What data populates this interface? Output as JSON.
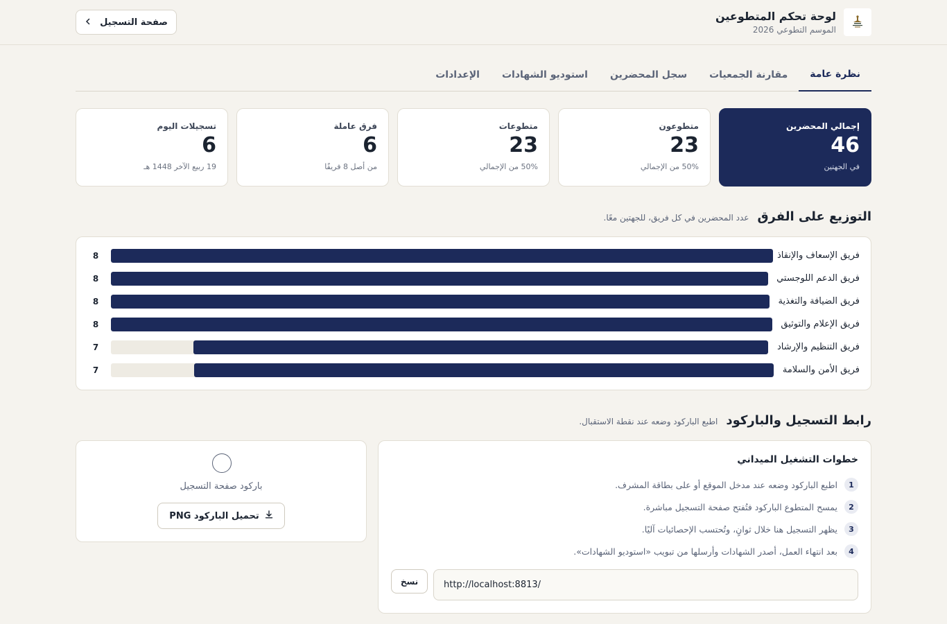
{
  "header": {
    "title": "لوحة تحكم المتطوعين",
    "subtitle": "الموسم التطوعي 2026",
    "registration_button": "صفحة التسجيل"
  },
  "tabs": [
    {
      "label": "نظرة عامة",
      "active": true
    },
    {
      "label": "مقارنة الجمعيات",
      "active": false
    },
    {
      "label": "سجل المحضرين",
      "active": false
    },
    {
      "label": "استوديو الشهادات",
      "active": false
    },
    {
      "label": "الإعدادات",
      "active": false
    }
  ],
  "stats": [
    {
      "label": "إجمالي المحضرين",
      "value": "46",
      "note": "في الجهتين"
    },
    {
      "label": "متطوعون",
      "value": "23",
      "note": "50% من الإجمالي"
    },
    {
      "label": "متطوعات",
      "value": "23",
      "note": "50% من الإجمالي"
    },
    {
      "label": "فرق عاملة",
      "value": "6",
      "note": "من أصل 8 فريقًا"
    },
    {
      "label": "تسجيلات اليوم",
      "value": "6",
      "note": "19 ربيع الآخر 1448 هـ"
    }
  ],
  "distribution": {
    "title": "التوزيع على الفرق",
    "subtitle": "عدد المحضرين في كل فريق، للجهتين معًا.",
    "max": 8,
    "teams": [
      {
        "label": "فريق الإسعاف والإنقاذ",
        "count": 8
      },
      {
        "label": "فريق الدعم اللوجستي",
        "count": 8
      },
      {
        "label": "فريق الضيافة والتغذية",
        "count": 8
      },
      {
        "label": "فريق الإعلام والتوثيق",
        "count": 8
      },
      {
        "label": "فريق التنظيم والإرشاد",
        "count": 7
      },
      {
        "label": "فريق الأمن والسلامة",
        "count": 7
      }
    ]
  },
  "registration": {
    "title": "رابط التسجيل والباركود",
    "subtitle": "اطبع الباركود وضعه عند نقطة الاستقبال.",
    "barcode_caption": "باركود صفحة التسجيل",
    "download_button": "تحميل الباركود PNG",
    "steps_title": "خطوات التشغيل الميداني",
    "steps": [
      {
        "num": "1",
        "text": "اطبع الباركود وضعه عند مدخل الموقع أو على بطاقة المشرف."
      },
      {
        "num": "2",
        "text": "يمسح المتطوع الباركود فتُفتح صفحة التسجيل مباشرة."
      },
      {
        "num": "3",
        "text": "يظهر التسجيل هنا خلال ثوانٍ، وتُحتسب الإحصائيات آليًا."
      },
      {
        "num": "4",
        "text": "بعد انتهاء العمل، أصدر الشهادات وأرسلها من تبويب «استوديو الشهادات»."
      }
    ],
    "url": "http://localhost:8813/",
    "copy_button": "نسخ"
  },
  "colors": {
    "primary": "#1c2a5a",
    "background": "#f5f3ee",
    "track": "#eeebe3"
  }
}
